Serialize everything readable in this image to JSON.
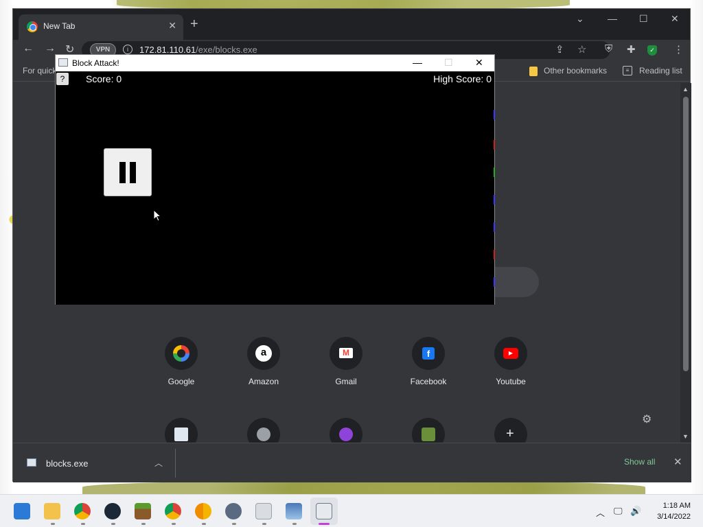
{
  "browser": {
    "tab_title": "New Tab",
    "address": {
      "host": "172.81.110.61",
      "path": "/exe/blocks.exe",
      "vpn_badge": "VPN"
    },
    "bookmarks_bar": {
      "hint": "For quick",
      "other_bookmarks": "Other bookmarks",
      "reading_list": "Reading list"
    },
    "shortcuts": [
      {
        "label": "Google",
        "icon": "google-logo-icon"
      },
      {
        "label": "Amazon",
        "icon": "amazon-logo-icon"
      },
      {
        "label": "Gmail",
        "icon": "gmail-logo-icon"
      },
      {
        "label": "Facebook",
        "icon": "facebook-logo-icon"
      },
      {
        "label": "Youtube",
        "icon": "youtube-logo-icon"
      }
    ],
    "downloads": {
      "file_name": "blocks.exe",
      "show_all": "Show all"
    }
  },
  "game": {
    "window_title": "Block Attack!",
    "help_label": "?",
    "score_text": "Score: 0",
    "high_score_text": "High Score: 0"
  },
  "taskbar": {
    "time": "1:18 AM",
    "date": "3/14/2022"
  },
  "colors": {
    "chrome_bg": "#35363a",
    "game_bg": "#000000",
    "accent_show_all": "#81c995"
  }
}
